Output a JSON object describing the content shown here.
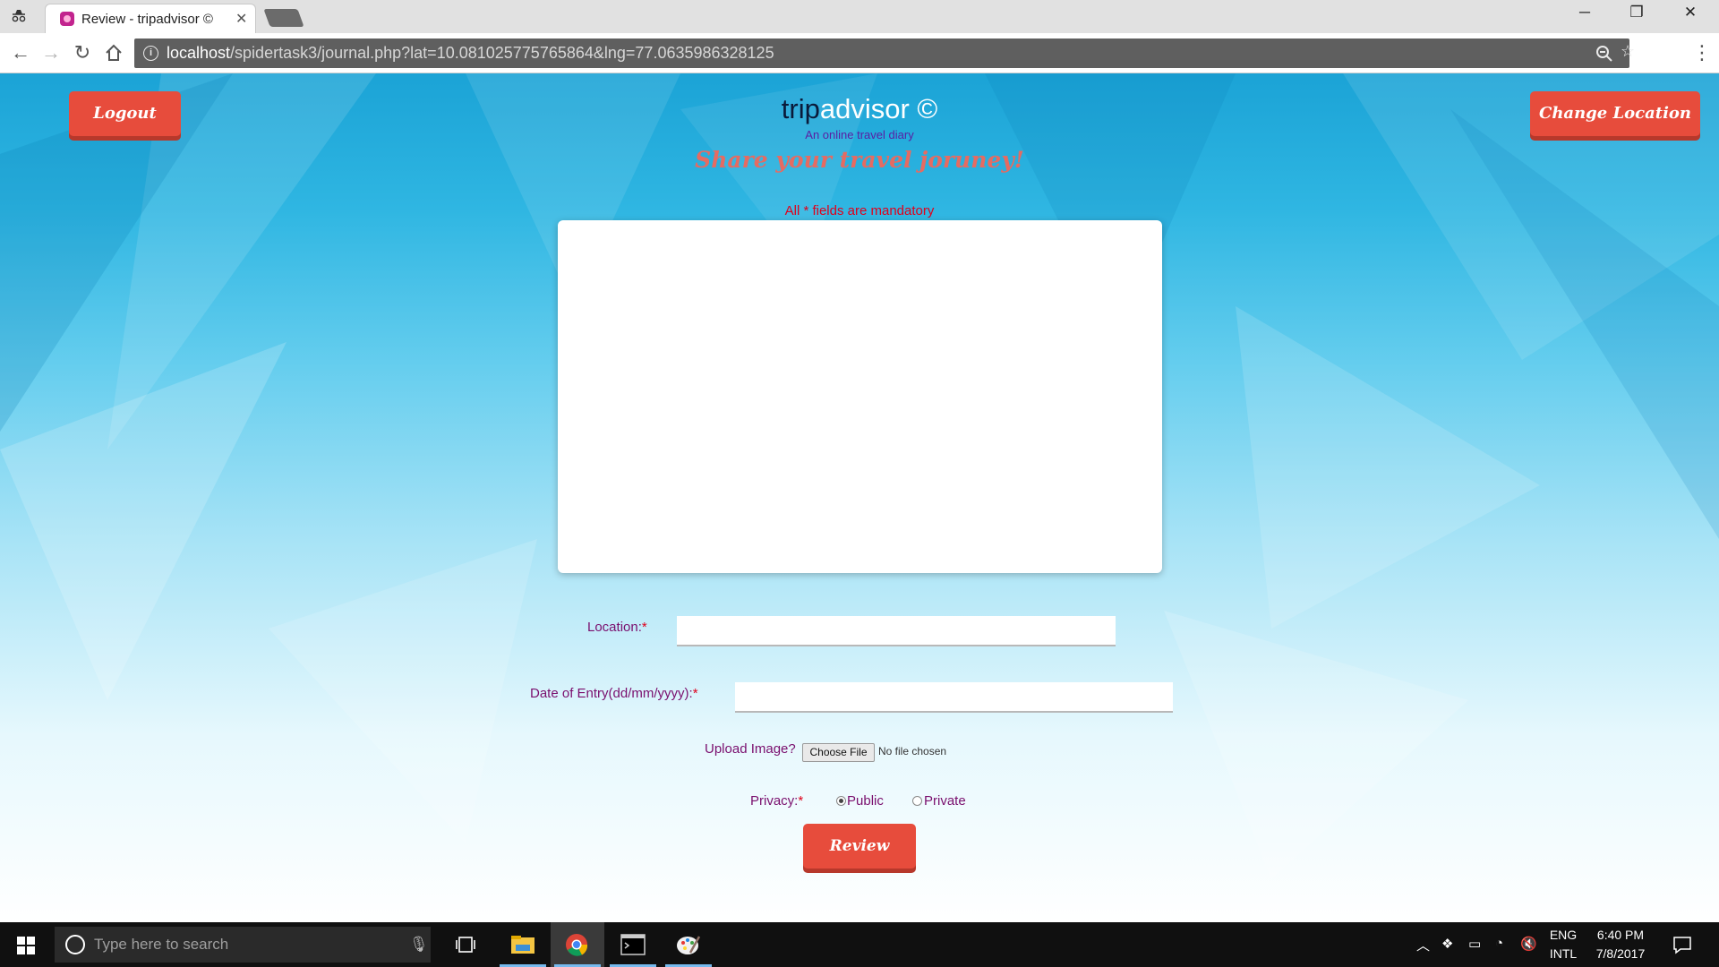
{
  "browser": {
    "tab_title": "Review - tripadvisor ©",
    "url_host": "localhost",
    "url_path": "/spidertask3/journal.php?lat=10.081025775765864&lng=77.0635986328125"
  },
  "header": {
    "logout_label": "Logout",
    "change_location_label": "Change Location",
    "brand_trip": "trip",
    "brand_advisor": "advisor ©",
    "tagline": "An online travel diary",
    "share_heading": "Share your travel joruney!",
    "mandatory_note": "All * fields are mandatory"
  },
  "form": {
    "location_label": "Location:",
    "date_label": "Date of Entry(dd/mm/yyyy):",
    "required_mark": "*",
    "location_value": "",
    "date_value": "",
    "upload_label": "Upload Image?",
    "choose_file_label": "Choose File",
    "file_status": "No file chosen",
    "privacy_label": "Privacy:",
    "privacy_options": [
      "Public",
      "Private"
    ],
    "privacy_selected": "Public",
    "submit_label": "Review"
  },
  "taskbar": {
    "search_placeholder": "Type here to search",
    "lang_top": "ENG",
    "lang_bottom": "INTL",
    "time": "6:40 PM",
    "date": "7/8/2017"
  },
  "colors": {
    "accent_red": "#e74c3c",
    "label_purple": "#7a0f6e",
    "required_red": "#e0001b",
    "sky_blue": "#1ba3d6"
  }
}
